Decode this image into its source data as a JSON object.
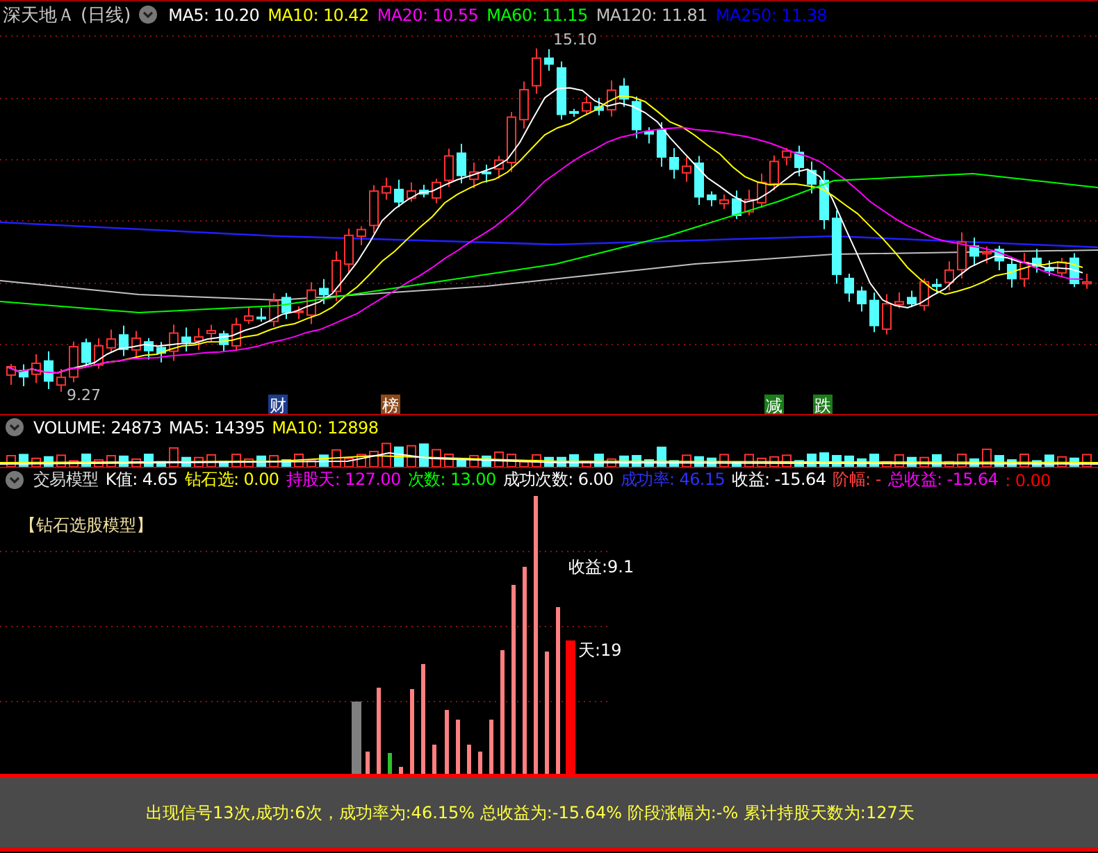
{
  "title_bar": {
    "stock": "深天地Ａ",
    "period": "(日线)",
    "indicators": [
      {
        "label": "MA5: 10.20",
        "color": "#ffffff"
      },
      {
        "label": "MA10: 10.42",
        "color": "#ffff00"
      },
      {
        "label": "MA20: 10.55",
        "color": "#ff00ff"
      },
      {
        "label": "MA60: 11.15",
        "color": "#00ff00"
      },
      {
        "label": "MA120: 11.81",
        "color": "#c0c0c0"
      },
      {
        "label": "MA250: 11.38",
        "color": "#0000ff"
      }
    ]
  },
  "price_chart": {
    "high_label": "15.10",
    "low_label": "9.27",
    "markers": [
      {
        "label": "财",
        "color": "#1c3c8c"
      },
      {
        "label": "榜",
        "color": "#8c4a1c"
      },
      {
        "label": "减",
        "color": "#1c7c1c"
      },
      {
        "label": "跌",
        "color": "#1c7c1c"
      }
    ]
  },
  "volume_panel": {
    "indicators": [
      {
        "label": "VOLUME: 24873",
        "color": "#ffffff"
      },
      {
        "label": "MA5: 14395",
        "color": "#ffffff"
      },
      {
        "label": "MA10: 12898",
        "color": "#ffff00"
      }
    ]
  },
  "model_panel": {
    "name": "交易模型",
    "indicators": [
      {
        "label": "K值: 4.65",
        "color": "#ffffff"
      },
      {
        "label": "钻石选: 0.00",
        "color": "#ffff00"
      },
      {
        "label": "持股天: 127.00",
        "color": "#ff00ff"
      },
      {
        "label": "次数: 13.00",
        "color": "#00ff00"
      },
      {
        "label": "成功次数: 6.00",
        "color": "#ffffff"
      },
      {
        "label": "成功率: 46.15",
        "color": "#3030ff"
      },
      {
        "label": "收益: -15.64",
        "color": "#ffffff"
      },
      {
        "label": "阶幅: -",
        "color": "#ff4040"
      },
      {
        "label": "总收益: -15.64",
        "color": "#ff00ff"
      },
      {
        "label": ": 0.00",
        "color": "#ff0000"
      }
    ],
    "title": "【钻石选股模型】",
    "profit_label": "收益:9.1",
    "days_label": "天:19"
  },
  "summary": "出现信号13次,成功:6次，成功率为:46.15% 总收益为:-15.64% 阶段涨幅为:-% 累计持股天数为:127天"
}
